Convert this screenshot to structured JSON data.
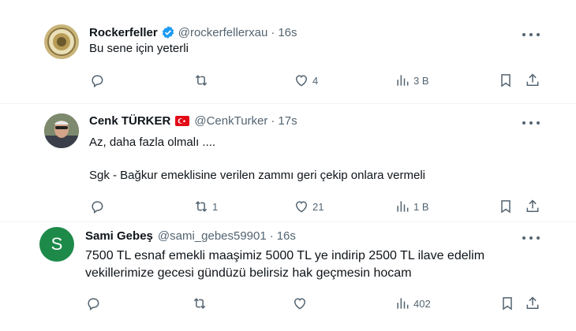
{
  "tweets": [
    {
      "name": "Rockerfeller",
      "handle": "@rockerfellerxau",
      "dot": "·",
      "time": "16s",
      "text": "Bu sene için yeterli",
      "reply_count": "",
      "retweet_count": "",
      "like_count": "4",
      "view_count": "3 B",
      "verified": true
    },
    {
      "name": "Cenk TÜRKER",
      "handle": "@CenkTurker",
      "dot": "·",
      "time": "17s",
      "text_line1": "Az, daha fazla olmalı ....",
      "text_line2": "Sgk - Bağkur emeklisine verilen zammı geri çekip onlara vermeli",
      "reply_count": "",
      "retweet_count": "1",
      "like_count": "21",
      "view_count": "1 B",
      "flag": "turkey-flag"
    },
    {
      "name": "Sami Gebeş",
      "handle": "@sami_gebes59901",
      "dot": "·",
      "time": "16s",
      "avatar_letter": "S",
      "text": "7500 TL esnaf emekli maaşimiz 5000 TL ye indirip 2500 TL ilave edelim vekillerimize gecesi gündüzü belirsiz hak geçmesin hocam",
      "reply_count": "",
      "retweet_count": "",
      "like_count": "",
      "view_count": "402"
    }
  ],
  "colors": {
    "text": "#0f1419",
    "muted": "#536471",
    "verified": "#1d9bf0",
    "avatar_green": "#1d8a4a",
    "divider": "#eff3f4"
  }
}
